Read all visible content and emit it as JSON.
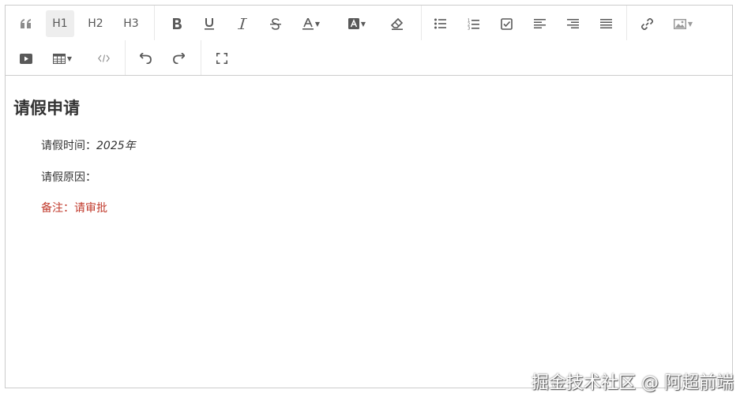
{
  "toolbar": {
    "h1_label": "H1",
    "h2_label": "H2",
    "h3_label": "H3"
  },
  "document": {
    "title": "请假申请",
    "time_label": "请假时间：",
    "time_value": "2025年",
    "reason_label": "请假原因：",
    "note": "备注：请审批"
  },
  "watermark": "掘金技术社区 @ 阿超前端",
  "colors": {
    "text": "#333333",
    "note": "#c0392b",
    "border": "#cccccc",
    "active_button_bg": "#eeeeee"
  }
}
